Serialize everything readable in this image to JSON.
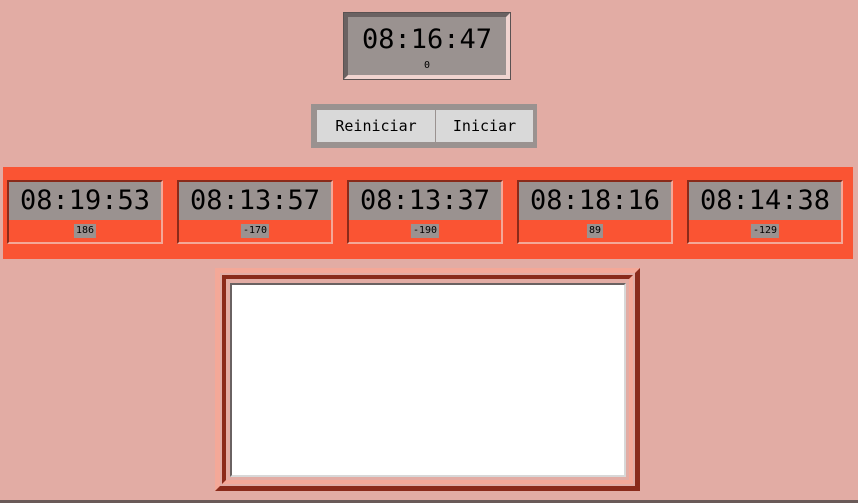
{
  "master": {
    "time": "08:16:47",
    "offset": "0"
  },
  "buttons": {
    "reset_label": "Reiniciar",
    "start_label": "Iniciar"
  },
  "clocks": [
    {
      "time": "08:19:53",
      "delta": "186"
    },
    {
      "time": "08:13:57",
      "delta": "-170"
    },
    {
      "time": "08:13:37",
      "delta": "-190"
    },
    {
      "time": "08:18:16",
      "delta": "89"
    },
    {
      "time": "08:14:38",
      "delta": "-129"
    }
  ],
  "log": {
    "text": ""
  },
  "colors": {
    "background": "#e2aca4",
    "clock_band": "#fa5433",
    "clock_face": "#9a9290",
    "text_area": "#ffffff"
  }
}
